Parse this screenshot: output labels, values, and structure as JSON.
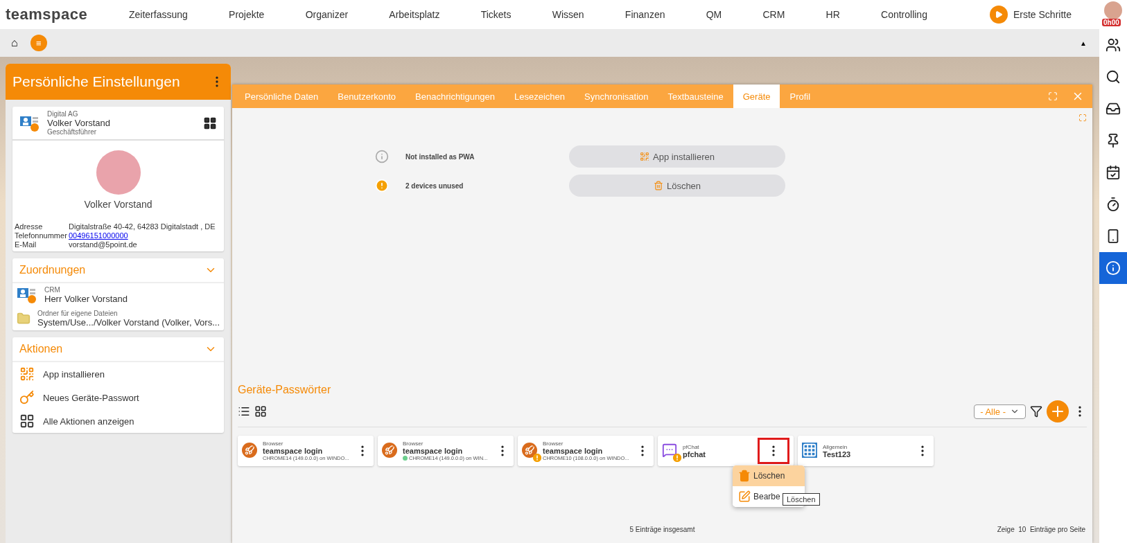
{
  "topbar": {
    "logo": "teamspace",
    "nav": [
      "Zeiterfassung",
      "Projekte",
      "Organizer",
      "Arbeitsplatz",
      "Tickets",
      "Wissen",
      "Finanzen",
      "QM",
      "CRM",
      "HR",
      "Controlling"
    ],
    "first_steps": "Erste Schritte",
    "timer_badge": "0h00"
  },
  "toolbar": {
    "home": "⌂",
    "menu": "≡",
    "collapse": "▲"
  },
  "rail": [
    {
      "kind": "people",
      "selected": false
    },
    {
      "kind": "search",
      "selected": false
    },
    {
      "kind": "inbox",
      "selected": false
    },
    {
      "kind": "pin",
      "selected": false
    },
    {
      "kind": "tasks",
      "selected": false
    },
    {
      "kind": "timer",
      "selected": false
    },
    {
      "kind": "phone",
      "selected": false
    },
    {
      "kind": "info",
      "selected": true
    }
  ],
  "panel": {
    "title": "Persönliche Einstellungen",
    "contact": {
      "company": "Digital AG",
      "name": "Volker Vorstand",
      "role": "Geschäftsführer",
      "display_name": "Volker Vorstand",
      "fields": [
        {
          "label": "Adresse",
          "value": "Digitalstraße 40-42, 64283 Digitalstadt , DE",
          "kind": "text"
        },
        {
          "label": "Telefonnummer",
          "value": "00496151000000",
          "kind": "link"
        },
        {
          "label": "E-Mail",
          "value": "vorstand@5point.de",
          "kind": "text"
        }
      ]
    },
    "assignments": {
      "title": "Zuordnungen",
      "items": [
        {
          "kind": "contact",
          "caption": "CRM",
          "text": "Herr Volker Vorstand"
        },
        {
          "kind": "folder",
          "caption": "Ordner für eigene Dateien",
          "text": "System/Use.../Volker Vorstand (Volker, Vors..."
        }
      ]
    },
    "actions": {
      "title": "Aktionen",
      "items": [
        {
          "kind": "qr",
          "label": "App installieren"
        },
        {
          "kind": "key",
          "label": "Neues Geräte-Passwort"
        },
        {
          "kind": "grid",
          "label": "Alle Aktionen anzeigen"
        }
      ]
    }
  },
  "window": {
    "tabs": [
      {
        "label": "Persönliche Daten",
        "selected": false
      },
      {
        "label": "Benutzerkonto",
        "selected": false
      },
      {
        "label": "Benachrichtigungen",
        "selected": false
      },
      {
        "label": "Lesezeichen",
        "selected": false
      },
      {
        "label": "Synchronisation",
        "selected": false
      },
      {
        "label": "Textbausteine",
        "selected": false
      },
      {
        "label": "Geräte",
        "selected": true
      },
      {
        "label": "Profil",
        "selected": false
      }
    ],
    "status": [
      {
        "kind": "info",
        "text": "Not installed as PWA",
        "button": "App installieren"
      },
      {
        "kind": "warning",
        "text": "2 devices unused",
        "button": "Löschen"
      }
    ],
    "passwords": {
      "title": "Geräte-Passwörter",
      "filter": "- Alle -",
      "cards": [
        {
          "kind": "browser",
          "caption": "Browser",
          "title": "teamspace login",
          "detail": "CHROME14 (149.0.0.0) on WINDO...",
          "warning": false,
          "online": false,
          "highlighted": false
        },
        {
          "kind": "browser",
          "caption": "Browser",
          "title": "teamspace login",
          "detail": "CHROME14 (149.0.0.0) on WIN...",
          "warning": false,
          "online": true,
          "highlighted": false
        },
        {
          "kind": "browser",
          "caption": "Browser",
          "title": "teamspace login",
          "detail": "CHROME10 (108.0.0.0) on WINDO...",
          "warning": true,
          "online": false,
          "highlighted": false
        },
        {
          "kind": "chat",
          "caption": "pfChat",
          "title": "pfchat",
          "warning": true,
          "online": false,
          "highlighted": true
        },
        {
          "kind": "grid",
          "caption": "Allgemein",
          "title": "Test123",
          "warning": false,
          "online": false,
          "highlighted": false
        }
      ],
      "menu": [
        {
          "kind": "trash",
          "label": "Löschen",
          "selected": true
        },
        {
          "kind": "edit",
          "label": "Bearbe",
          "selected": false
        }
      ],
      "tooltip": "Löschen",
      "total": "5 Einträge insgesamt",
      "page_prefix": "Zeige",
      "page_size": "10",
      "page_suffix": "Einträge pro Seite"
    }
  }
}
